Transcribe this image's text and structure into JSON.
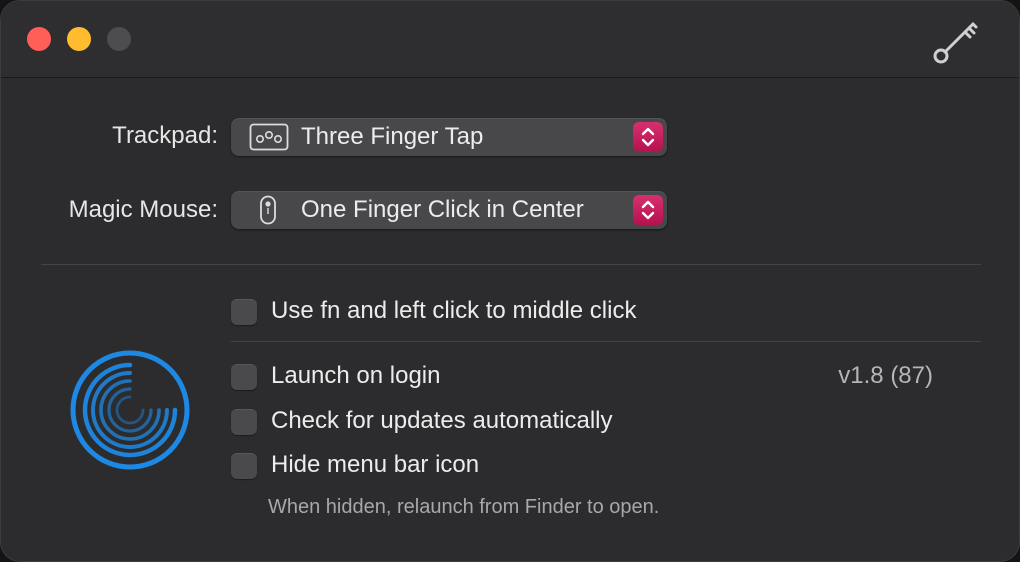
{
  "window": {
    "buttons": {
      "close": "close-button",
      "minimize": "minimize-button",
      "zoom": "zoom-button"
    },
    "toolbar_icon": "key-icon"
  },
  "trackpad": {
    "label": "Trackpad:",
    "icon": "trackpad-icon",
    "selected": "Three Finger Tap"
  },
  "magic_mouse": {
    "label": "Magic Mouse:",
    "icon": "mouse-icon",
    "selected": "One Finger Click in Center"
  },
  "options": {
    "fn_click": {
      "label": "Use fn and left click to middle click",
      "checked": false
    },
    "launch_login": {
      "label": "Launch on login",
      "checked": false
    },
    "check_updates": {
      "label": "Check for updates automatically",
      "checked": false
    },
    "hide_menu_icon": {
      "label": "Hide menu bar icon",
      "checked": false
    }
  },
  "version": "v1.8 (87)",
  "hint": "When hidden, relaunch from Finder to open.",
  "colors": {
    "accent": "#c2185b",
    "logo_blue": "#1e88e5",
    "background": "#2c2c2e"
  }
}
